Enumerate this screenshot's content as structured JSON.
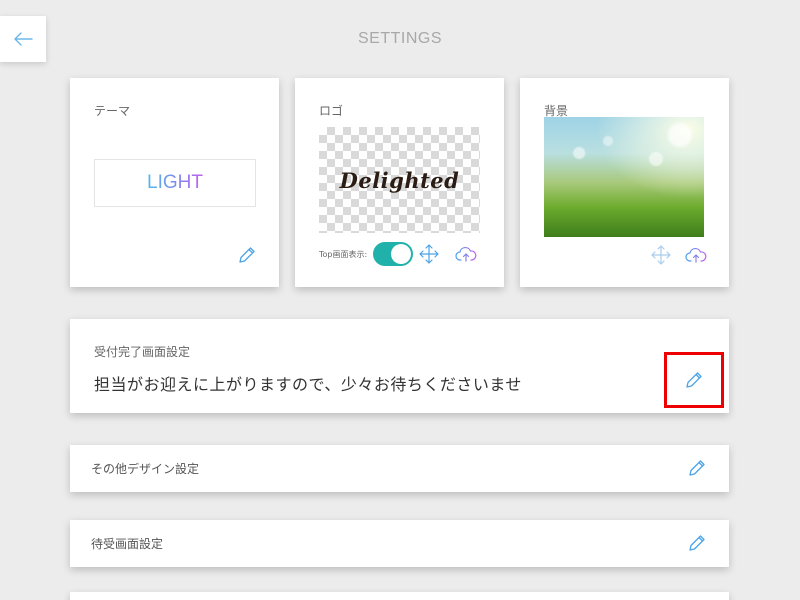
{
  "header": {
    "title": "SETTINGS",
    "back_icon": "arrow-left-icon"
  },
  "theme_card": {
    "label": "テーマ",
    "value": "LIGHT",
    "edit_icon": "pencil-icon"
  },
  "logo_card": {
    "label": "ロゴ",
    "logo_text": "Delighted",
    "toggle_label": "Top画面表示:",
    "toggle_on": true,
    "move_icon": "move-arrows-icon",
    "upload_icon": "cloud-upload-icon"
  },
  "background_card": {
    "label": "背景",
    "move_icon": "move-arrows-icon",
    "upload_icon": "cloud-upload-icon"
  },
  "reception_card": {
    "label": "受付完了画面設定",
    "message": "担当がお迎えに上がりますので、少々お待ちくださいませ",
    "edit_icon": "pencil-icon"
  },
  "design_card": {
    "label": "その他デザイン設定",
    "edit_icon": "pencil-icon"
  },
  "standby_card": {
    "label": "待受画面設定",
    "edit_icon": "pencil-icon"
  },
  "colors": {
    "accent_blue": "#4aa3e8",
    "toggle": "#20b2aa",
    "highlight": "#e00000",
    "background": "#ececec"
  }
}
